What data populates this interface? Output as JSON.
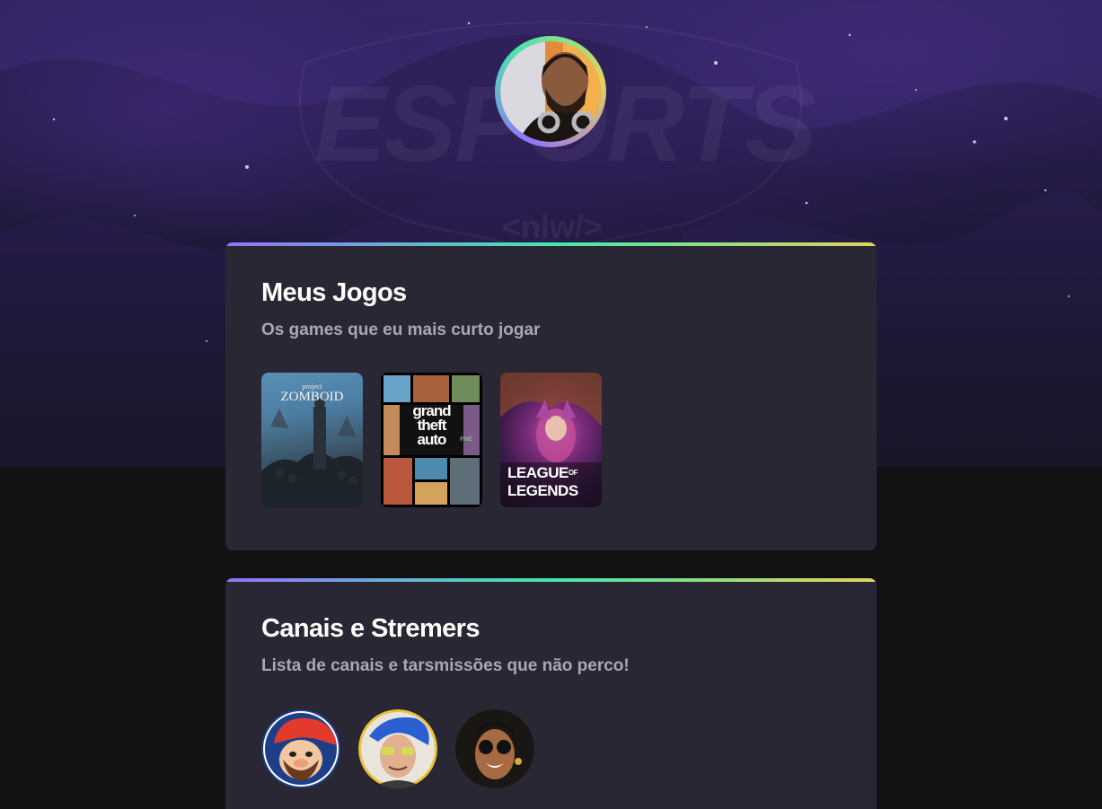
{
  "hero": {
    "background_watermark": "ESPORTS",
    "background_sub": "<nlw/>"
  },
  "profile": {
    "avatar": "profile-avatar"
  },
  "sections": {
    "games": {
      "title": "Meus Jogos",
      "subtitle": "Os games que eu mais curto jogar",
      "items": [
        {
          "name": "Project Zomboid",
          "logo_top": "project",
          "logo_main": "ZOMBOID"
        },
        {
          "name": "Grand Theft Auto V",
          "logo_lines": [
            "grand",
            "theft",
            "auto"
          ],
          "logo_badge": "FIVE"
        },
        {
          "name": "League of Legends",
          "logo_line1": "LEAGUE",
          "logo_of": "OF",
          "logo_line2": "LEGENDS"
        }
      ]
    },
    "streamers": {
      "title": "Canais e Stremers",
      "subtitle": "Lista de canais e tarsmissões que não perco!",
      "items": [
        {
          "name": "streamer-1"
        },
        {
          "name": "streamer-2"
        },
        {
          "name": "streamer-3"
        }
      ]
    }
  },
  "colors": {
    "background": "#121214",
    "card": "#292733",
    "gradient": [
      "#9572fc",
      "#43e7ad",
      "#e2d45c"
    ],
    "subtitle": "#a8a8b3"
  }
}
